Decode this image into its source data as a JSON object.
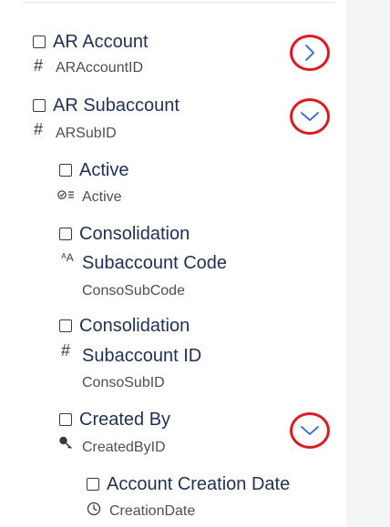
{
  "fields": [
    {
      "label": "AR Account",
      "field_id": "ARAccountID",
      "type_icon": "hash-icon",
      "expand_state": "collapsed"
    },
    {
      "label": "AR Subaccount",
      "field_id": "ARSubID",
      "type_icon": "hash-icon",
      "expand_state": "expanded"
    },
    {
      "label": "Active",
      "field_id": "Active",
      "type_icon": "checklist-icon"
    },
    {
      "label_line1": "Consolidation",
      "label_line2": "Subaccount Code",
      "field_id": "ConsoSubCode",
      "type_icon": "text-aa-icon"
    },
    {
      "label_line1": "Consolidation",
      "label_line2": "Subaccount ID",
      "field_id": "ConsoSubID",
      "type_icon": "hash-icon"
    },
    {
      "label": "Created By",
      "field_id": "CreatedByID",
      "type_icon": "key-icon",
      "expand_state": "expanded"
    },
    {
      "label": "Account Creation Date",
      "field_id": "CreationDate",
      "type_icon": "clock-icon"
    }
  ],
  "colors": {
    "title": "#1f2f57",
    "toggle_ring": "#e0191f",
    "chevron": "#2b63e3"
  }
}
